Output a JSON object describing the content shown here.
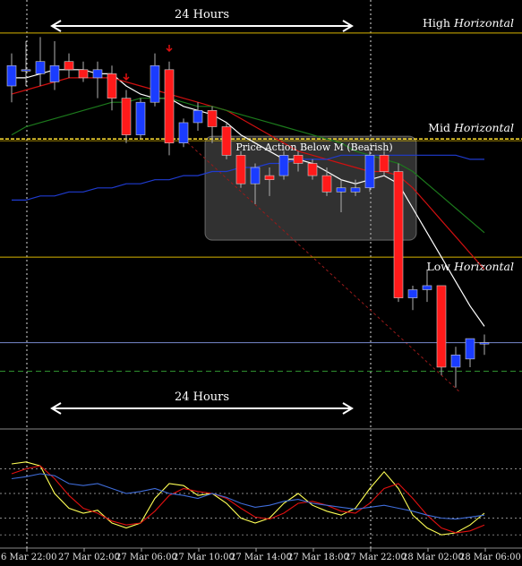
{
  "chart_data": {
    "type": "candlestick",
    "colors": {
      "bullish": "#1a3cff",
      "bearish": "#ff1a1a",
      "wick": "#b0b0b0",
      "horizontal_level": "#d8b400",
      "mid_level": "#ffe033",
      "current_price_line": "#7788cc",
      "green_dash_line": "#2f8f2f",
      "ma_white": "#ffffff",
      "ma_red": "#d01010",
      "ma_green": "#1c7a1c",
      "ma_blue": "#1f3bd0",
      "osc_yellow": "#ffff55",
      "osc_red": "#e01010",
      "osc_blue": "#3f6cd8",
      "arrow": "#e01010",
      "diag_trend": "#9a1a1a"
    },
    "x_axis_labels": [
      "6 Mar 22:00",
      "27 Mar 02:00",
      "27 Mar 06:00",
      "27 Mar 10:00",
      "27 Mar 14:00",
      "27 Mar 18:00",
      "27 Mar 22:00",
      "28 Mar 02:00",
      "28 Mar 06:00"
    ],
    "annotations": {
      "level_high": {
        "label": "High",
        "label_italic": "Horizontal"
      },
      "level_mid": {
        "label": "Mid",
        "label_italic": "Horizontal"
      },
      "level_low": {
        "label": "Low",
        "label_italic": "Horizontal"
      },
      "box_label": "Price Action Below M (Bearish)",
      "span_top": "24 Hours",
      "span_bottom": "24 Hours"
    },
    "price_range": [
      0,
      100
    ],
    "levels": {
      "high": 93,
      "mid": 67,
      "low": 38,
      "current": 17,
      "green_dash": 10
    },
    "candles": [
      {
        "o": 80,
        "h": 88,
        "l": 76,
        "c": 85
      },
      {
        "o": 84,
        "h": 91,
        "l": 80,
        "c": 84
      },
      {
        "o": 83,
        "h": 92,
        "l": 80,
        "c": 86
      },
      {
        "o": 81,
        "h": 91,
        "l": 79,
        "c": 85
      },
      {
        "o": 86,
        "h": 88,
        "l": 82,
        "c": 84
      },
      {
        "o": 84,
        "h": 86,
        "l": 81,
        "c": 82
      },
      {
        "o": 82,
        "h": 86,
        "l": 77,
        "c": 84
      },
      {
        "o": 83,
        "h": 85,
        "l": 74,
        "c": 77
      },
      {
        "o": 77,
        "h": 79,
        "l": 66,
        "c": 68
      },
      {
        "o": 68,
        "h": 77,
        "l": 67,
        "c": 76
      },
      {
        "o": 76,
        "h": 88,
        "l": 75,
        "c": 85
      },
      {
        "o": 84,
        "h": 86,
        "l": 63,
        "c": 66
      },
      {
        "o": 66,
        "h": 72,
        "l": 65,
        "c": 71
      },
      {
        "o": 71,
        "h": 76,
        "l": 69,
        "c": 74
      },
      {
        "o": 74,
        "h": 75,
        "l": 66,
        "c": 70
      },
      {
        "o": 70,
        "h": 71,
        "l": 62,
        "c": 63
      },
      {
        "o": 63,
        "h": 64,
        "l": 55,
        "c": 56
      },
      {
        "o": 56,
        "h": 61,
        "l": 51,
        "c": 60
      },
      {
        "o": 58,
        "h": 60,
        "l": 53,
        "c": 57
      },
      {
        "o": 58,
        "h": 64,
        "l": 57,
        "c": 63
      },
      {
        "o": 63,
        "h": 64,
        "l": 59,
        "c": 61
      },
      {
        "o": 61,
        "h": 62,
        "l": 57,
        "c": 58
      },
      {
        "o": 58,
        "h": 60,
        "l": 53,
        "c": 54
      },
      {
        "o": 54,
        "h": 57,
        "l": 49,
        "c": 55
      },
      {
        "o": 54,
        "h": 57,
        "l": 53,
        "c": 55
      },
      {
        "o": 55,
        "h": 64,
        "l": 54,
        "c": 63
      },
      {
        "o": 63,
        "h": 64,
        "l": 58,
        "c": 59
      },
      {
        "o": 59,
        "h": 61,
        "l": 27,
        "c": 28
      },
      {
        "o": 28,
        "h": 31,
        "l": 25,
        "c": 30
      },
      {
        "o": 30,
        "h": 35,
        "l": 27,
        "c": 31
      },
      {
        "o": 31,
        "h": 31,
        "l": 9,
        "c": 11
      },
      {
        "o": 11,
        "h": 16,
        "l": 6,
        "c": 14
      },
      {
        "o": 13,
        "h": 18,
        "l": 11,
        "c": 18
      },
      {
        "o": 17,
        "h": 19,
        "l": 14,
        "c": 17
      }
    ],
    "series": [
      {
        "key": "ma_white",
        "values": [
          82,
          82,
          83,
          84,
          84,
          84,
          83,
          83,
          80,
          78,
          77,
          77,
          75,
          74,
          73,
          71,
          68,
          66,
          64,
          62,
          62,
          61,
          59,
          57,
          56,
          57,
          58,
          56,
          50,
          44,
          38,
          32,
          26,
          21
        ]
      },
      {
        "key": "ma_red",
        "values": [
          78,
          79,
          80,
          81,
          82,
          82,
          82,
          82,
          81,
          80,
          79,
          78,
          77,
          76,
          75,
          74,
          72,
          70,
          68,
          66,
          64,
          63,
          62,
          61,
          60,
          59,
          59,
          58,
          55,
          51,
          47,
          43,
          39,
          35
        ]
      },
      {
        "key": "ma_green",
        "values": [
          68,
          70,
          71,
          72,
          73,
          74,
          75,
          76,
          76,
          77,
          77,
          77,
          76,
          75,
          75,
          74,
          73,
          72,
          71,
          70,
          69,
          68,
          67,
          66,
          64,
          63,
          62,
          61,
          59,
          56,
          53,
          50,
          47,
          44
        ]
      },
      {
        "key": "ma_blue",
        "values": [
          52,
          52,
          53,
          53,
          54,
          54,
          55,
          55,
          56,
          56,
          57,
          57,
          58,
          58,
          59,
          59,
          60,
          60,
          61,
          61,
          62,
          62,
          62,
          63,
          63,
          63,
          63,
          63,
          63,
          63,
          63,
          63,
          62,
          62
        ]
      }
    ],
    "oscillator_range": [
      0,
      100
    ],
    "oscillator": [
      {
        "key": "osc_yellow",
        "values": [
          80,
          82,
          78,
          50,
          35,
          30,
          33,
          20,
          15,
          20,
          45,
          60,
          58,
          48,
          50,
          40,
          25,
          20,
          25,
          40,
          50,
          38,
          32,
          28,
          35,
          55,
          72,
          55,
          28,
          15,
          8,
          10,
          18,
          30
        ]
      },
      {
        "key": "osc_red",
        "values": [
          70,
          75,
          78,
          65,
          48,
          35,
          30,
          22,
          18,
          20,
          32,
          48,
          55,
          52,
          50,
          45,
          35,
          26,
          24,
          30,
          40,
          42,
          38,
          32,
          30,
          40,
          55,
          60,
          45,
          28,
          15,
          10,
          12,
          18
        ]
      },
      {
        "key": "osc_blue",
        "values": [
          65,
          67,
          70,
          68,
          60,
          58,
          60,
          55,
          50,
          52,
          55,
          50,
          48,
          45,
          50,
          46,
          40,
          36,
          38,
          42,
          44,
          40,
          38,
          36,
          34,
          36,
          38,
          35,
          32,
          28,
          25,
          24,
          26,
          28
        ]
      }
    ],
    "oscillator_levels": [
      75,
      50,
      25,
      8
    ]
  }
}
